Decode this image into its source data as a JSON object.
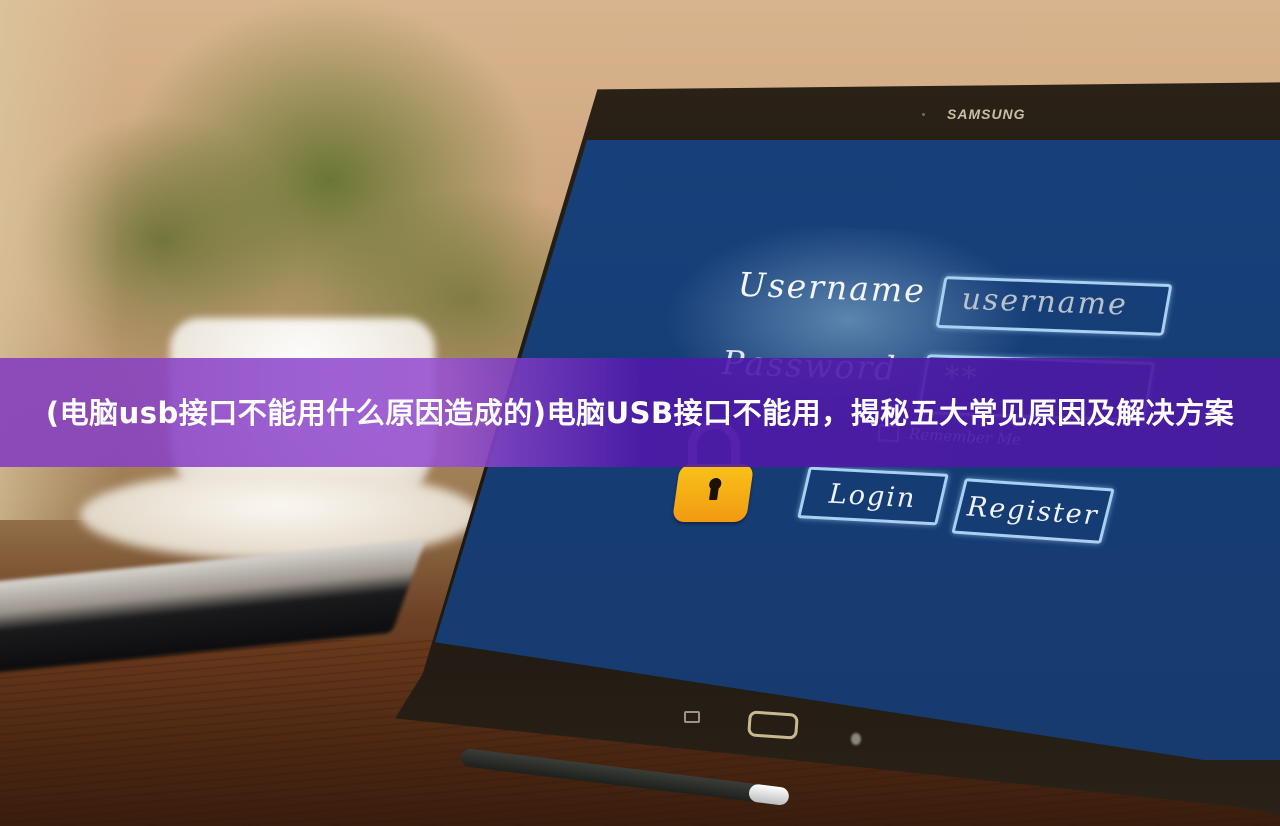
{
  "article": {
    "title": "(电脑usb接口不能用什么原因造成的)电脑USB接口不能用，揭秘五大常见原因及解决方案"
  },
  "tablet": {
    "brand": "SAMSUNG",
    "login_screen": {
      "username_label": "Username",
      "username_field_value": "username",
      "password_label": "Password",
      "password_field_value": "**",
      "remember_me_label": "Remember Me",
      "remember_me_checked": false,
      "login_button": "Login",
      "register_button": "Register",
      "lock_icon": "padlock-icon"
    },
    "hardware_buttons": [
      "back-button",
      "home-button",
      "recent-apps-button"
    ]
  },
  "colors": {
    "banner_purple": "#7a3cc0",
    "screen_blue": "#17407a",
    "field_outline": "#a9d0f3",
    "lock_orange": "#f5ab14"
  }
}
